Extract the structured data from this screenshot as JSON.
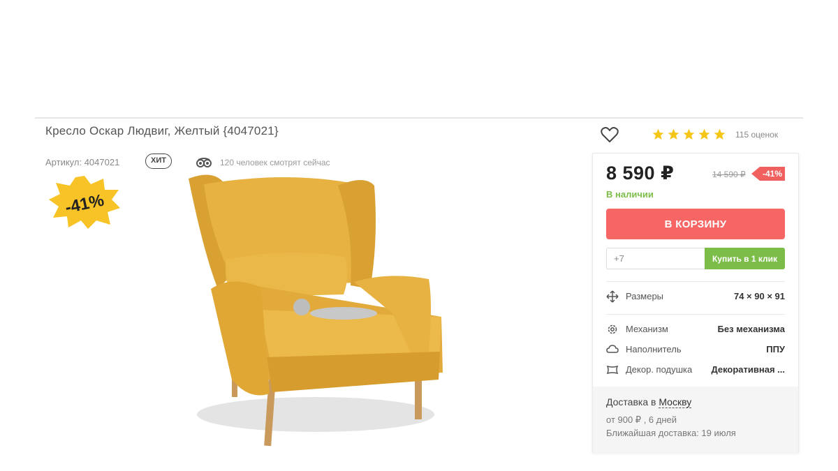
{
  "product": {
    "title": "Кресло Оскар Людвиг, Желтый {4047021}",
    "sku": "Артикул: 4047021",
    "hit_badge": "ХИТ",
    "viewers": "120 человек смотрят сейчас",
    "discount_burst": "-41%",
    "image_icon": "armchair-image"
  },
  "rating": {
    "stars": 5,
    "count_label": "115 оценок",
    "star_color": "#f5c518"
  },
  "purchase": {
    "price": "8 590 ₽",
    "old_price": "14 590 ₽",
    "discount_tag": "-41%",
    "stock": "В наличии",
    "cart_button": "В КОРЗИНУ",
    "phone_placeholder": "+7",
    "oneclick_button": "Купить в 1 клик"
  },
  "specs": [
    {
      "icon": "move-arrows-icon",
      "label": "Размеры",
      "value": "74 × 90 × 91"
    },
    {
      "icon": "gear-icon",
      "label": "Механизм",
      "value": "Без механизма"
    },
    {
      "icon": "cloud-icon",
      "label": "Наполнитель",
      "value": "ППУ"
    },
    {
      "icon": "pillow-icon",
      "label": "Декор. подушка",
      "value": "Декоративная ..."
    }
  ],
  "delivery": {
    "prefix": "Доставка в ",
    "city": "Москву",
    "cost": "от 900 ₽ , 6 дней",
    "nearest": "Ближайшая доставка: 19 июля"
  },
  "colors": {
    "accent_red": "#f56664",
    "accent_green": "#7cbd49",
    "burst_yellow": "#f7c326",
    "chair_yellow": "#e6ad3a"
  }
}
